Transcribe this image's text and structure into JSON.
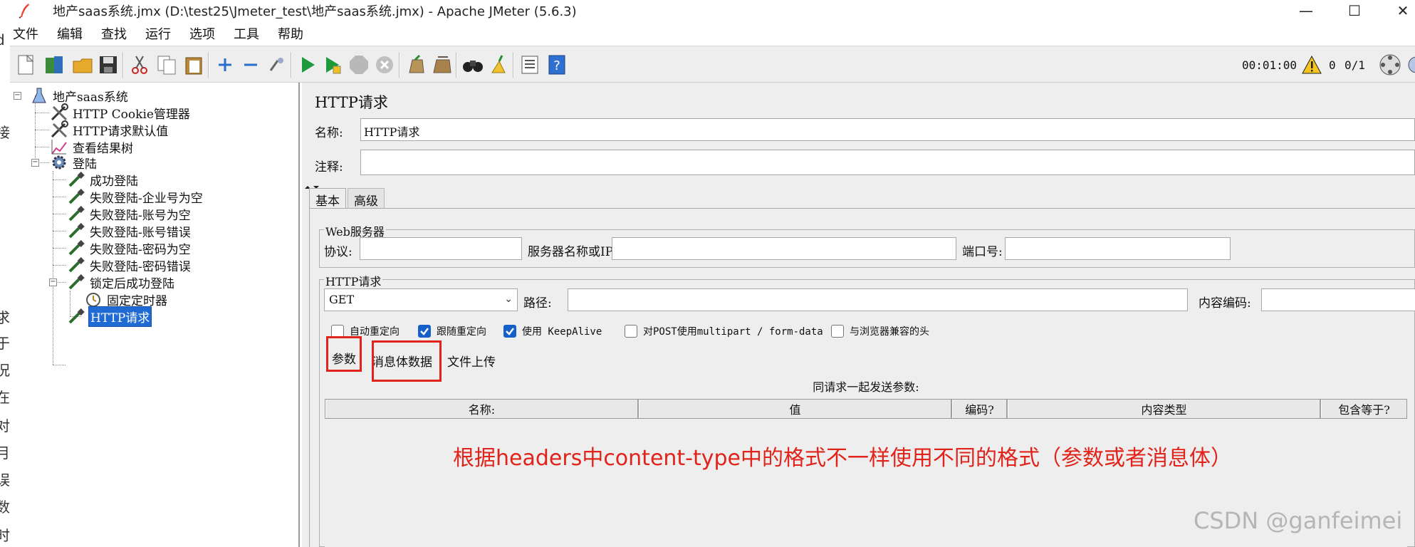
{
  "window": {
    "title": "地产saas系统.jmx (D:\\test25\\Jmeter_test\\地产saas系统.jmx) - Apache JMeter (5.6.3)",
    "minimize_glyph": "—",
    "maximize_glyph": "☐",
    "close_glyph": "✕"
  },
  "left_strip_chars": [
    "d",
    "接",
    "求",
    "于",
    "况",
    "在",
    "对",
    "月",
    "误",
    "数",
    "时"
  ],
  "menu": [
    "文件",
    "编辑",
    "查找",
    "运行",
    "选项",
    "工具",
    "帮助"
  ],
  "toolbar": {
    "elapsed": "00:01:00",
    "warning_count": "0",
    "threads": "0/1",
    "icons": [
      "new-icon",
      "templates-icon",
      "open-icon",
      "save-icon",
      "cut-icon",
      "copy-icon",
      "paste-icon",
      "expand-icon",
      "collapse-icon",
      "toggle-icon",
      "start-icon",
      "start-no-pause-icon",
      "stop-icon",
      "shutdown-icon",
      "clear-icon",
      "clear-all-icon",
      "search-icon",
      "reset-search-icon",
      "function-helper-icon",
      "help-icon"
    ]
  },
  "tree": {
    "root": "地产saas系统",
    "nodes": [
      {
        "label": "HTTP Cookie管理器",
        "icon": "wrench-icon"
      },
      {
        "label": "HTTP请求默认值",
        "icon": "wrench-icon"
      },
      {
        "label": "查看结果树",
        "icon": "chart-icon"
      },
      {
        "label": "登陆",
        "icon": "gear-icon"
      },
      {
        "label": "成功登陆",
        "icon": "sampler-icon"
      },
      {
        "label": "失败登陆-企业号为空",
        "icon": "sampler-icon"
      },
      {
        "label": "失败登陆-账号为空",
        "icon": "sampler-icon"
      },
      {
        "label": "失败登陆-账号错误",
        "icon": "sampler-icon"
      },
      {
        "label": "失败登陆-密码为空",
        "icon": "sampler-icon"
      },
      {
        "label": "失败登陆-密码错误",
        "icon": "sampler-icon"
      },
      {
        "label": "锁定后成功登陆",
        "icon": "sampler-icon"
      },
      {
        "label": "固定定时器",
        "icon": "timer-icon"
      },
      {
        "label": "HTTP请求",
        "icon": "sampler-icon"
      }
    ]
  },
  "panel": {
    "title": "HTTP请求",
    "name_label": "名称:",
    "name_value": "HTTP请求",
    "comment_label": "注释:",
    "comment_value": ""
  },
  "tabs": [
    "基本",
    "高级"
  ],
  "web_server": {
    "group_title": "Web服务器",
    "protocol_label": "协议:",
    "server_label": "服务器名称或IP:",
    "port_label": "端口号:"
  },
  "http_request": {
    "group_title": "HTTP请求",
    "method": "GET",
    "path_label": "路径:",
    "encoding_label": "内容编码:"
  },
  "checkboxes": [
    {
      "label": "自动重定向",
      "checked": false
    },
    {
      "label": "跟随重定向",
      "checked": true
    },
    {
      "label": "使用 KeepAlive",
      "checked": true
    },
    {
      "label": "对POST使用multipart / form-data",
      "checked": false
    },
    {
      "label": "与浏览器兼容的头",
      "checked": false
    }
  ],
  "subtabs": [
    "参数",
    "消息体数据",
    "文件上传"
  ],
  "params_table": {
    "caption": "同请求一起发送参数:",
    "columns": [
      "名称:",
      "值",
      "编码?",
      "内容类型",
      "包含等于?"
    ]
  },
  "annotation": "根据headers中content-type中的格式不一样使用不同的格式（参数或者消息体）",
  "watermark": "CSDN @ganfeimei"
}
